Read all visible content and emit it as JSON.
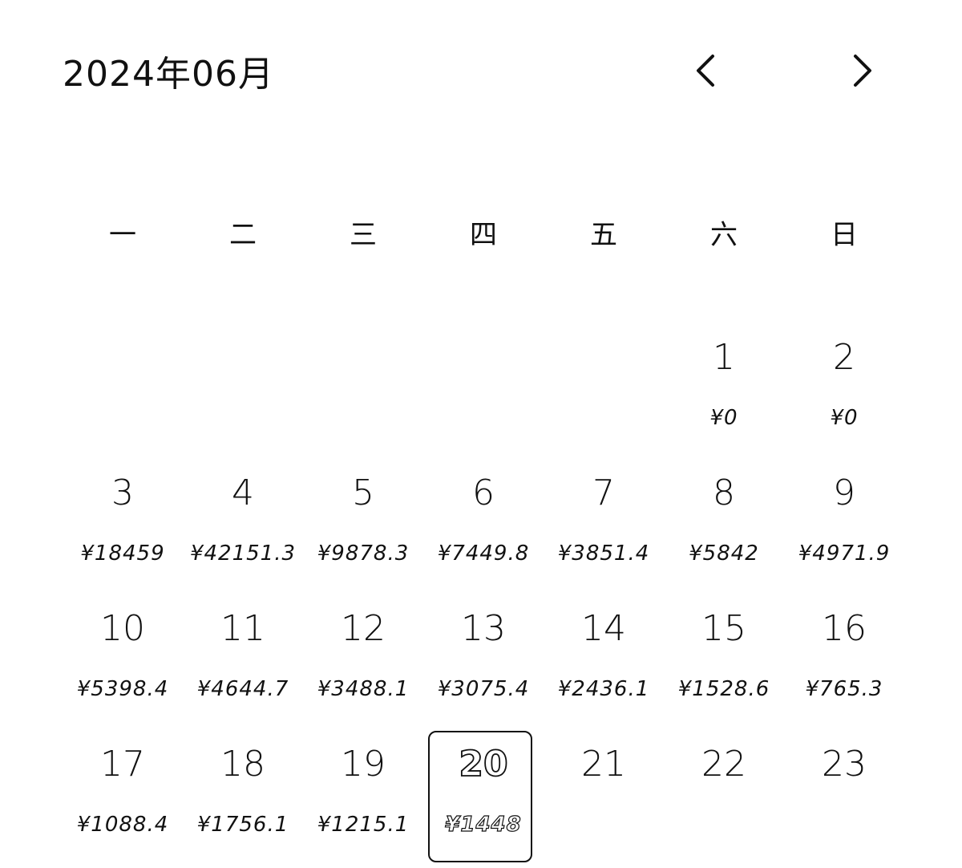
{
  "header": {
    "month_title": "2024年06月",
    "prev_icon": "chevron-left-icon",
    "next_icon": "chevron-right-icon"
  },
  "weekdays": [
    "一",
    "二",
    "三",
    "四",
    "五",
    "六",
    "日"
  ],
  "leading_blank_days": 5,
  "selected_day": "20",
  "days": [
    {
      "day": "1",
      "amount": "¥0"
    },
    {
      "day": "2",
      "amount": "¥0"
    },
    {
      "day": "3",
      "amount": "¥18459"
    },
    {
      "day": "4",
      "amount": "¥42151.3"
    },
    {
      "day": "5",
      "amount": "¥9878.3"
    },
    {
      "day": "6",
      "amount": "¥7449.8"
    },
    {
      "day": "7",
      "amount": "¥3851.4"
    },
    {
      "day": "8",
      "amount": "¥5842"
    },
    {
      "day": "9",
      "amount": "¥4971.9"
    },
    {
      "day": "10",
      "amount": "¥5398.4"
    },
    {
      "day": "11",
      "amount": "¥4644.7"
    },
    {
      "day": "12",
      "amount": "¥3488.1"
    },
    {
      "day": "13",
      "amount": "¥3075.4"
    },
    {
      "day": "14",
      "amount": "¥2436.1"
    },
    {
      "day": "15",
      "amount": "¥1528.6"
    },
    {
      "day": "16",
      "amount": "¥765.3"
    },
    {
      "day": "17",
      "amount": "¥1088.4"
    },
    {
      "day": "18",
      "amount": "¥1756.1"
    },
    {
      "day": "19",
      "amount": "¥1215.1"
    },
    {
      "day": "20",
      "amount": "¥1448"
    },
    {
      "day": "21",
      "amount": ""
    },
    {
      "day": "22",
      "amount": ""
    },
    {
      "day": "23",
      "amount": ""
    }
  ]
}
